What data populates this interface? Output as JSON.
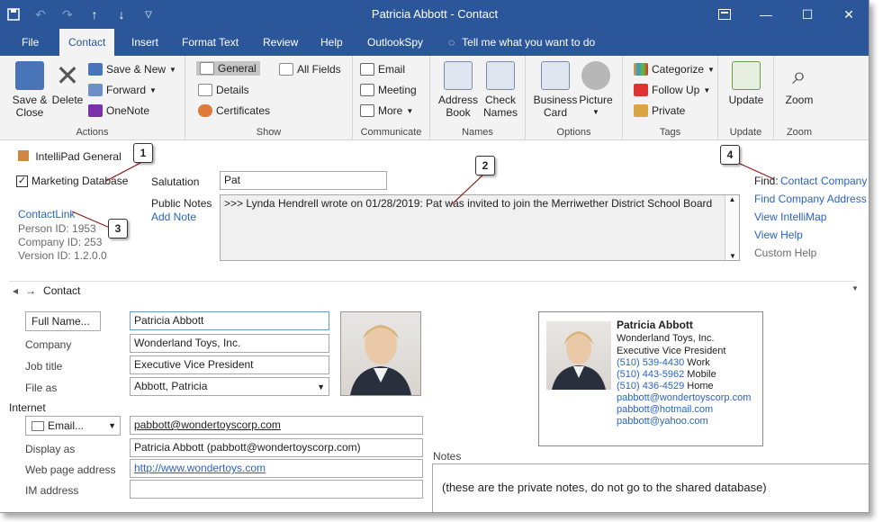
{
  "window": {
    "title": "Patricia Abbott  -  Contact"
  },
  "tabs": [
    "File",
    "Contact",
    "Insert",
    "Format Text",
    "Review",
    "Help",
    "OutlookSpy"
  ],
  "tell_me": "Tell me what you want to do",
  "ribbon": {
    "actions": {
      "label": "Actions",
      "save_close": "Save &\nClose",
      "delete": "Delete",
      "save_new": "Save & New",
      "forward": "Forward",
      "onenote": "OneNote"
    },
    "show": {
      "label": "Show",
      "general": "General",
      "details": "Details",
      "certificates": "Certificates",
      "all_fields": "All Fields"
    },
    "communicate": {
      "label": "Communicate",
      "email": "Email",
      "meeting": "Meeting",
      "more": "More"
    },
    "names": {
      "label": "Names",
      "address_book": "Address\nBook",
      "check_names": "Check\nNames"
    },
    "options": {
      "label": "Options",
      "business_card": "Business\nCard",
      "picture": "Picture"
    },
    "tags": {
      "label": "Tags",
      "categorize": "Categorize",
      "follow_up": "Follow Up",
      "private": "Private"
    },
    "update": {
      "label": "Update",
      "button": "Update"
    },
    "zoom": {
      "label": "Zoom",
      "button": "Zoom"
    }
  },
  "intellipad": {
    "title": "IntelliPad General",
    "marketing_db": "Marketing Database",
    "salutation_label": "Salutation",
    "salutation_value": "Pat",
    "public_notes_label": "Public Notes",
    "add_note": "Add Note",
    "public_notes_text": ">>> Lynda Hendrell wrote on 01/28/2019: Pat was invited to join the Merriwether District School Board",
    "contactlink": "ContactLink",
    "person_id": "Person ID: 1953",
    "company_id": "Company ID: 253",
    "version_id": "Version ID: 1.2.0.0",
    "find_label": "Find:",
    "find_contact": "Contact",
    "find_company": "Company",
    "find_company_address": "Find Company Address",
    "view_intellimap": "View IntelliMap",
    "view_help": "View Help",
    "custom_help": "Custom Help",
    "callouts": [
      "1",
      "2",
      "3",
      "4"
    ]
  },
  "contact": {
    "section": "Contact",
    "full_name_btn": "Full Name...",
    "full_name": "Patricia Abbott",
    "company_label": "Company",
    "company": "Wonderland Toys, Inc.",
    "job_title_label": "Job title",
    "job_title": "Executive Vice President",
    "file_as_label": "File as",
    "file_as": "Abbott, Patricia",
    "internet_label": "Internet",
    "email_btn": "Email...",
    "email": "pabbott@wondertoyscorp.com",
    "display_as_label": "Display as",
    "display_as": "Patricia Abbott (pabbott@wondertoyscorp.com)",
    "web_label": "Web page address",
    "web": "http://www.wondertoys.com",
    "im_label": "IM address",
    "notes_label": "Notes",
    "notes_text": "(these are the private notes, do not go to the shared database)"
  },
  "card": {
    "name": "Patricia Abbott",
    "company": "Wonderland Toys, Inc.",
    "title": "Executive Vice President",
    "phone_work": "(510) 539-4430",
    "work": "Work",
    "phone_mobile": "(510) 443-5962",
    "mobile": "Mobile",
    "phone_home": "(510) 436-4529",
    "home": "Home",
    "email1": "pabbott@wondertoyscorp.com",
    "email2": "pabbott@hotmail.com",
    "email3": "pabbott@yahoo.com"
  },
  "colors": {
    "accent": "#2b579a",
    "link": "#2a63c4"
  }
}
